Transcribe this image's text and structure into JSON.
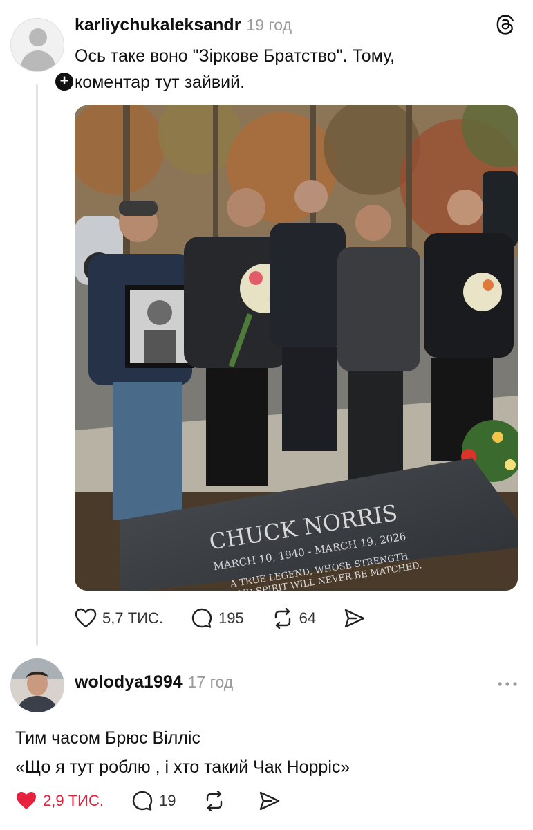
{
  "post1": {
    "username": "karliychukaleksandr",
    "timestamp": "19 год",
    "text_line1": "Ось таке воно \"Зіркове Братство\". Тому,",
    "text_line2": "коментар тут зайвий.",
    "image": {
      "tombstone_name": "CHUCK NORRIS",
      "tombstone_dates": "MARCH 10, 1940 - MARCH 19, 2026",
      "tombstone_epitaph1": "A TRUE LEGEND, WHOSE STRENGTH",
      "tombstone_epitaph2": "AND SPIRIT WILL NEVER BE MATCHED."
    },
    "likes": "5,7 ТИС.",
    "comments": "195",
    "reposts": "64"
  },
  "post2": {
    "username": "wolodya1994",
    "timestamp": "17 год",
    "text_line1": "Тим часом Брюс Вілліс",
    "text_line2": "«Що я тут роблю , і хто такий Чак Норріс»",
    "likes": "2,9 ТИС.",
    "comments": "19",
    "liked_color": "#e5213d"
  }
}
